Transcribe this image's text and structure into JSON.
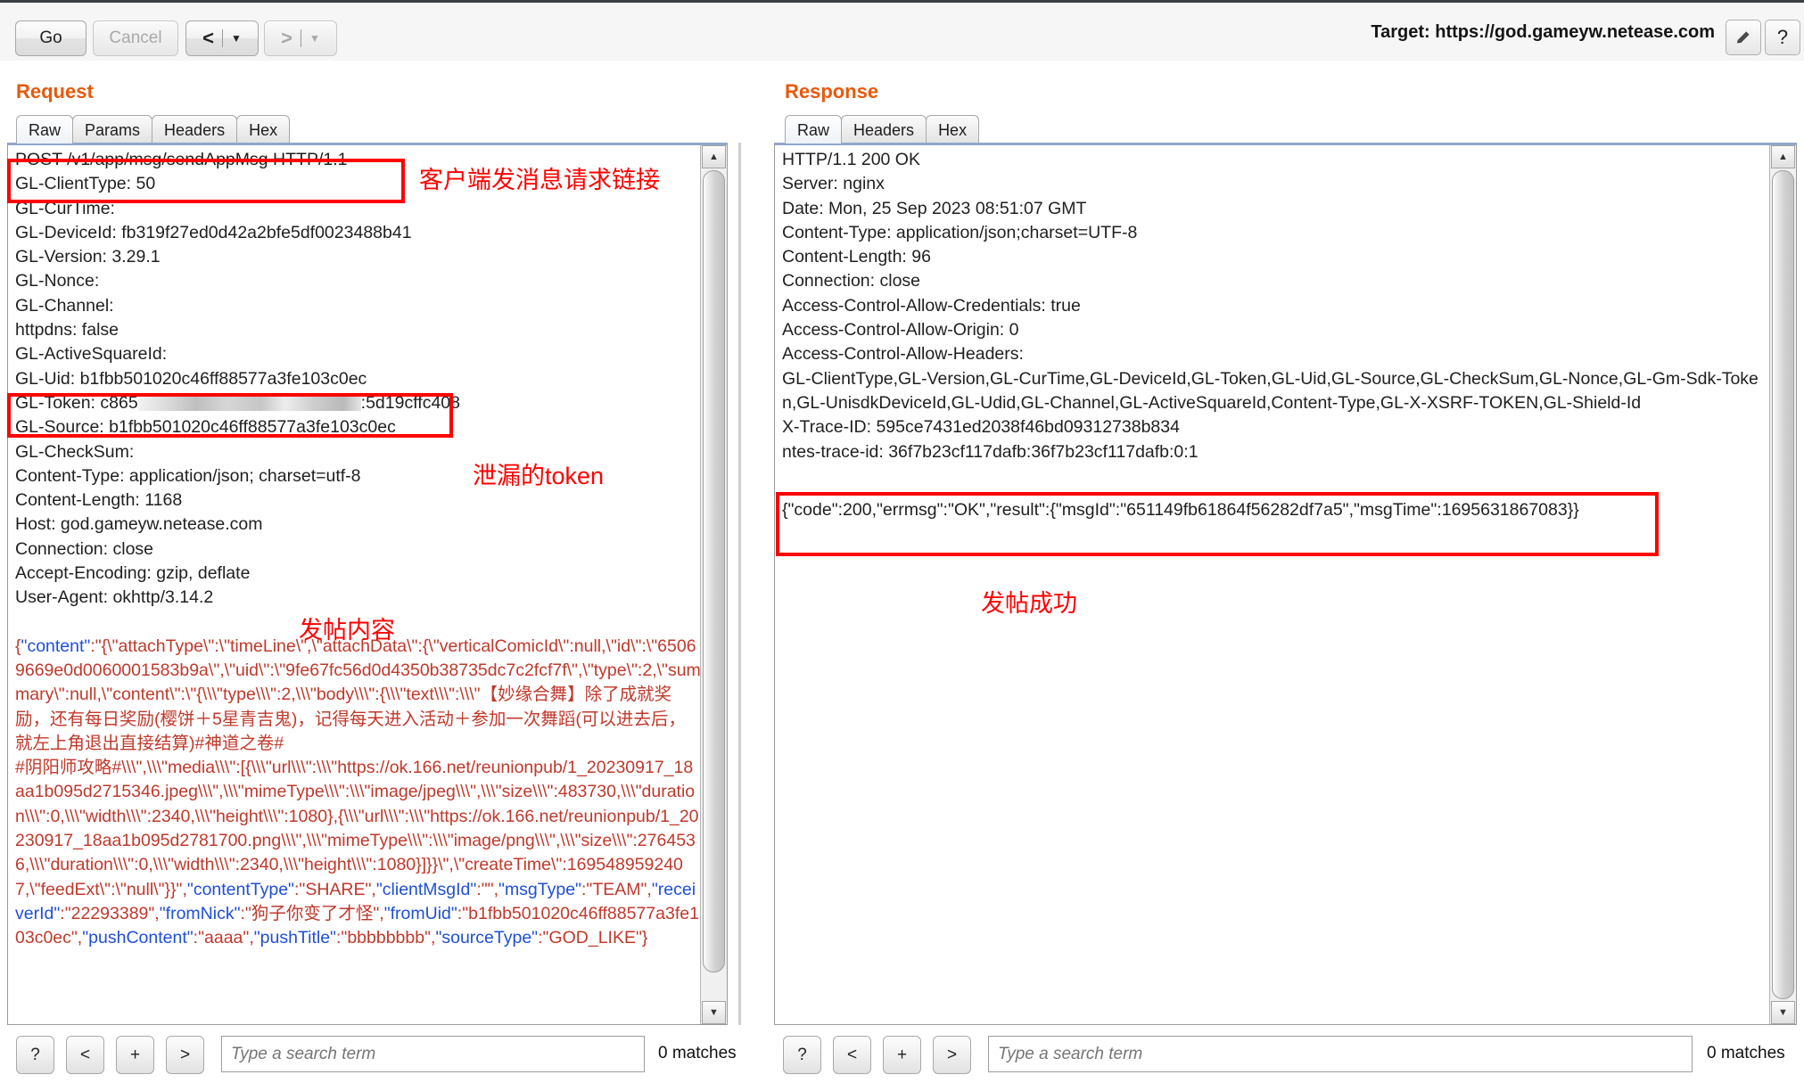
{
  "toolbar": {
    "go_label": "Go",
    "cancel_label": "Cancel",
    "back_label": "<",
    "forward_label": ">",
    "caret": "▼",
    "target_label": "Target: https://god.gameyw.netease.com",
    "pencil_icon": "pencil-icon",
    "help_label": "?"
  },
  "request": {
    "title": "Request",
    "tabs": [
      {
        "label": "Raw",
        "active": true
      },
      {
        "label": "Params",
        "active": false
      },
      {
        "label": "Headers",
        "active": false
      },
      {
        "label": "Hex",
        "active": false
      }
    ],
    "request_line": "POST /v1/app/msg/sendAppMsg HTTP/1.1",
    "headers": [
      "GL-ClientType: 50",
      "GL-CurTime:",
      "GL-DeviceId: fb319f27ed0d42a2bfe5df0023488b41",
      "GL-Version: 3.29.1",
      "GL-Nonce:",
      "GL-Channel:",
      "httpdns: false",
      "GL-ActiveSquareId:",
      "GL-Uid: b1fbb501020c46ff88577a3fe103c0ec",
      "GL-Token: c865████████████████:5d19cffc408",
      "GL-Source: b1fbb501020c46ff88577a3fe103c0ec",
      "GL-CheckSum:",
      "Content-Type: application/json; charset=utf-8",
      "Content-Length: 1168",
      "Host: god.gameyw.netease.com",
      "Connection: close",
      "Accept-Encoding: gzip, deflate",
      "User-Agent: okhttp/3.14.2"
    ],
    "token_prefix": "GL-Token: c865",
    "token_suffix": ":5d19cffc408",
    "body": "{\"content\":\"{\\\"attachType\\\":\\\"timeLine\\\",\\\"attachData\\\":{\\\"verticalComicId\\\":null,\\\"id\\\":\\\"65069669e0d0060001583b9a\\\",\\\"uid\\\":\\\"9fe67fc56d0d4350b38735dc7c2fcf7f\\\",\\\"type\\\":2,\\\"summary\\\":null,\\\"content\\\":\\\"{\\\\\\\"type\\\\\\\":2,\\\\\\\"body\\\\\\\":{\\\\\\\"text\\\\\\\":\\\\\\\"【妙缘合舞】除了成就奖励，还有每日奖励(樱饼＋5星青吉鬼)，记得每天进入活动＋参加一次舞蹈(可以进去后，就左上角退出直接结算)#神道之卷#\n#阴阳师攻略#\\\\\\\",\\\\\\\"media\\\\\\\":[{\\\\\\\"url\\\\\\\":\\\\\\\"https://ok.166.net/reunionpub/1_20230917_18aa1b095d2715346.jpeg\\\\\\\",\\\\\\\"mimeType\\\\\\\":\\\\\\\"image/jpeg\\\\\\\",\\\\\\\"size\\\\\\\":483730,\\\\\\\"duration\\\\\\\":0,\\\\\\\"width\\\\\\\":2340,\\\\\\\"height\\\\\\\":1080},{\\\\\\\"url\\\\\\\":\\\\\\\"https://ok.166.net/reunionpub/1_20230917_18aa1b095d2781700.png\\\\\\\",\\\\\\\"mimeType\\\\\\\":\\\\\\\"image/png\\\\\\\",\\\\\\\"size\\\\\\\":2764536,\\\\\\\"duration\\\\\\\":0,\\\\\\\"width\\\\\\\":2340,\\\\\\\"height\\\\\\\":1080}]}}\\\",\\\"createTime\\\":1695489592407,\\\"feedExt\\\":\\\"null\\\"}}\",\"contentType\":\"SHARE\",\"clientMsgId\":\"\",\"msgType\":\"TEAM\",\"receiverId\":\"22293389\",\"fromNick\":\"狗子你变了才怪\",\"fromUid\":\"b1fbb501020c46ff88577a3fe103c0ec\",\"pushContent\":\"aaaa\",\"pushTitle\":\"bbbbbbbb\",\"sourceType\":\"GOD_LIKE\"}",
    "search": {
      "help_label": "?",
      "prev_label": "<",
      "plus_label": "+",
      "next_label": ">",
      "placeholder": "Type a search term",
      "value": "",
      "matches": "0 matches"
    }
  },
  "response": {
    "title": "Response",
    "tabs": [
      {
        "label": "Raw",
        "active": true
      },
      {
        "label": "Headers",
        "active": false
      },
      {
        "label": "Hex",
        "active": false
      }
    ],
    "status_line": "HTTP/1.1 200 OK",
    "headers": [
      "Server: nginx",
      "Date: Mon, 25 Sep 2023 08:51:07 GMT",
      "Content-Type: application/json;charset=UTF-8",
      "Content-Length: 96",
      "Connection: close",
      "Access-Control-Allow-Credentials: true",
      "Access-Control-Allow-Origin: 0",
      "Access-Control-Allow-Headers:",
      "GL-ClientType,GL-Version,GL-CurTime,GL-DeviceId,GL-Token,GL-Uid,GL-Source,GL-CheckSum,GL-Nonce,GL-Gm-Sdk-Token,GL-UnisdkDeviceId,GL-Udid,GL-Channel,GL-ActiveSquareId,Content-Type,GL-X-XSRF-TOKEN,GL-Shield-Id",
      "X-Trace-ID: 595ce7431ed2038f46bd09312738b834",
      "ntes-trace-id: 36f7b23cf117dafb:36f7b23cf117dafb:0:1"
    ],
    "body": "{\"code\":200,\"errmsg\":\"OK\",\"result\":{\"msgId\":\"651149fb61864f56282df7a5\",\"msgTime\":1695631867083}}",
    "search": {
      "help_label": "?",
      "prev_label": "<",
      "plus_label": "+",
      "next_label": ">",
      "placeholder": "Type a search term",
      "value": "",
      "matches": "0 matches"
    }
  },
  "annotations": {
    "request_line_note": "客户端发消息请求链接",
    "token_note": "泄漏的token",
    "body_note": "发帖内容",
    "response_note": "发帖成功"
  },
  "colors": {
    "annotation_red": "#ff0000",
    "panel_title_orange": "#e8590c",
    "json_key_blue": "#1f4fd8",
    "json_body_red": "#c0392b"
  }
}
